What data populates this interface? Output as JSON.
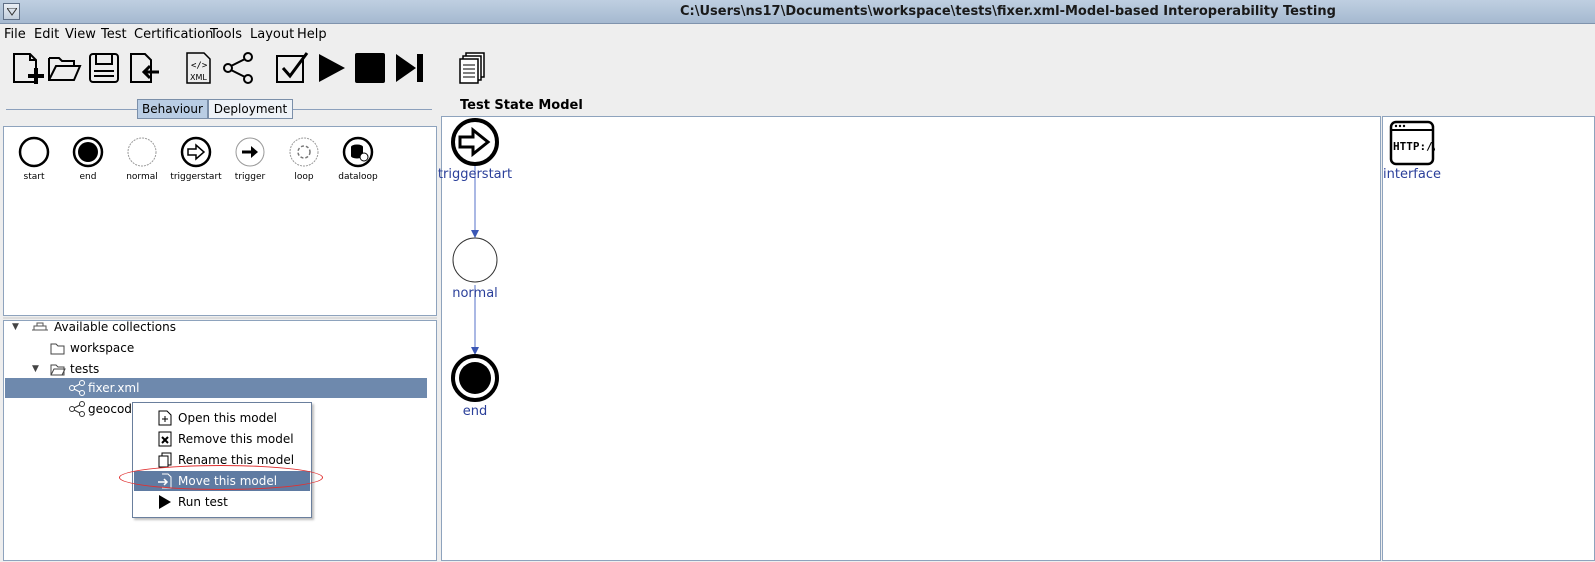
{
  "window": {
    "title": "C:\\Users\\ns17\\Documents\\workspace\\tests\\fixer.xml-Model-based Interoperability Testing"
  },
  "menu": [
    "File",
    "Edit",
    "View",
    "Test",
    "Certification",
    "Tools",
    "Layout",
    "Help"
  ],
  "toolbar": {
    "buttons": [
      {
        "name": "new-model-icon"
      },
      {
        "name": "open-folder-icon"
      },
      {
        "name": "save-icon"
      },
      {
        "name": "export-icon"
      },
      {
        "name": "xml-file-icon",
        "label": "XML"
      },
      {
        "name": "share-graph-icon"
      },
      {
        "name": "validate-checkbox-icon"
      },
      {
        "name": "play-icon"
      },
      {
        "name": "stop-icon"
      },
      {
        "name": "step-forward-icon"
      },
      {
        "name": "copy-documents-icon"
      }
    ]
  },
  "tabs": {
    "behaviour": "Behaviour",
    "deployment": "Deployment"
  },
  "palette": {
    "items": [
      "start",
      "end",
      "normal",
      "triggerstart",
      "trigger",
      "loop",
      "dataloop"
    ]
  },
  "tree": {
    "root": "Available collections",
    "workspace": "workspace",
    "tests": "tests",
    "fixer": "fixer.xml",
    "geocode": "geocod"
  },
  "context_menu": {
    "open": "Open this model",
    "remove": "Remove this model",
    "rename": "Rename this model",
    "move": "Move this model",
    "run": "Run test"
  },
  "canvas": {
    "title": "Test State Model",
    "nodes": {
      "triggerstart": "triggerstart",
      "normal": "normal",
      "end": "end"
    }
  },
  "right_panel": {
    "interface_label": "interface",
    "http_label": "HTTP://"
  },
  "colors": {
    "selection": "#6e89ad",
    "highlight": "#5f7ba2",
    "node_label": "#2a3f9a",
    "annotation_oval": "#e03030"
  }
}
